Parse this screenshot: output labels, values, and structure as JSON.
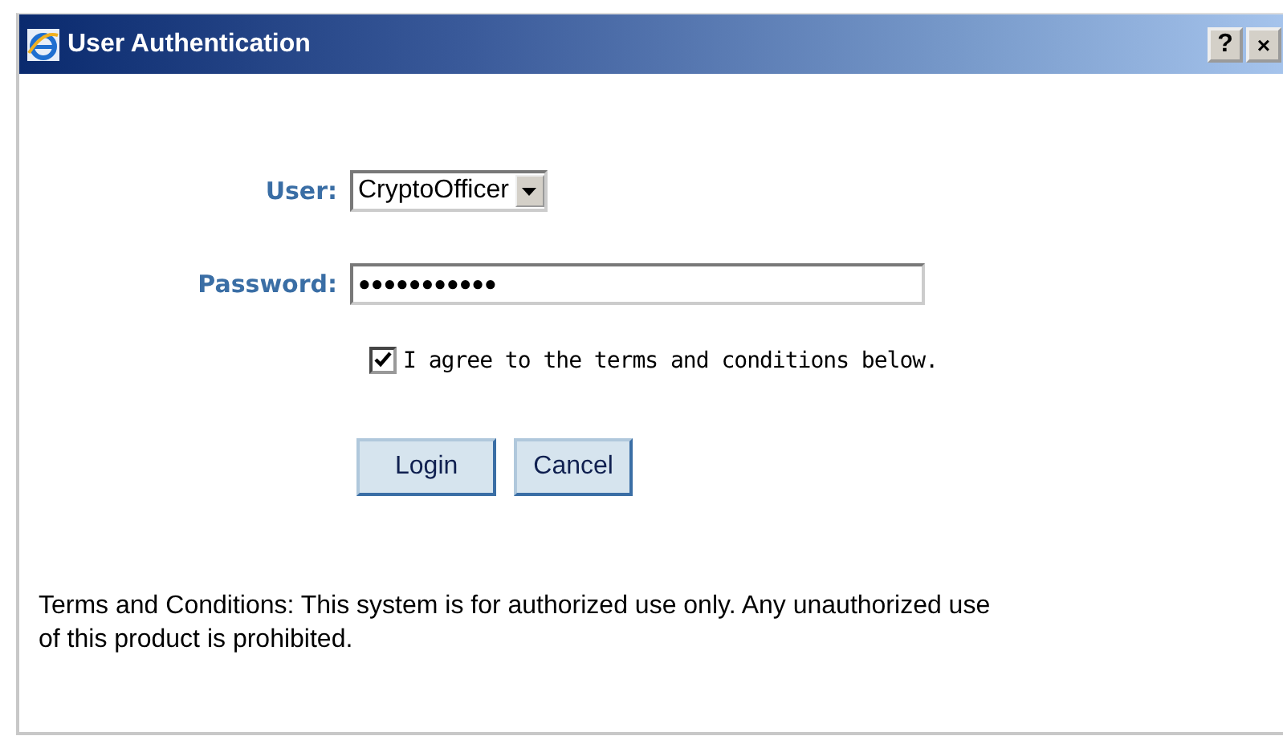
{
  "window": {
    "title": "User Authentication",
    "buttons": [
      {
        "label": "?",
        "kind": "help"
      },
      {
        "label": "×",
        "kind": "close"
      }
    ]
  },
  "form": {
    "user": {
      "label": "User:",
      "value": "CryptoOfficer"
    },
    "password": {
      "label": "Password:",
      "value": "●●●●●●●●●●●"
    },
    "agree": {
      "label": "I agree to the terms and conditions below.",
      "checked": true
    }
  },
  "buttons": [
    "Login",
    "Cancel"
  ],
  "terms": "Terms and Conditions: This system is for authorized use only. Any unauthorized use of this product is prohibited."
}
